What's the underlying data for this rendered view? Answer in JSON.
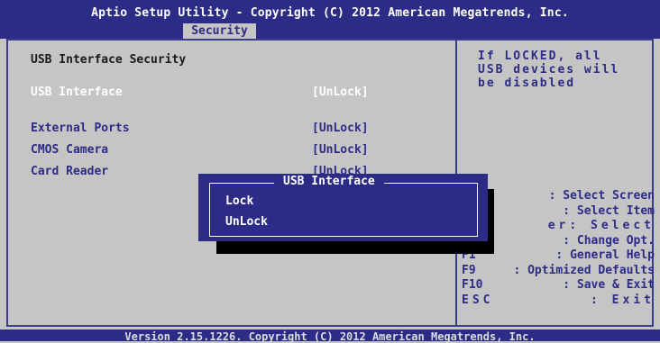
{
  "header": {
    "title": "Aptio Setup Utility - Copyright (C) 2012 American Megatrends, Inc.",
    "active_tab": "Security"
  },
  "main": {
    "heading": "USB Interface Security",
    "items": [
      {
        "label": "USB Interface",
        "value": "[UnLock]",
        "selected": true
      },
      {
        "label": "External Ports",
        "value": "[UnLock]",
        "selected": false
      },
      {
        "label": "CMOS Camera",
        "value": "[UnLock]",
        "selected": false
      },
      {
        "label": "Card Reader",
        "value": "[UnLock]",
        "selected": false
      }
    ]
  },
  "help": {
    "line1": "If LOCKED, all",
    "line2": "USB devices will",
    "line3": "be disabled"
  },
  "keys": [
    {
      "key": "",
      "desc": ": Select Screen"
    },
    {
      "key": "",
      "desc": ": Select Item"
    },
    {
      "key": "",
      "desc": "er: Select"
    },
    {
      "key": "",
      "desc": ": Change Opt."
    },
    {
      "key": "F1",
      "desc": ": General Help"
    },
    {
      "key": "F9",
      "desc": ": Optimized Defaults"
    },
    {
      "key": "F10",
      "desc": ": Save & Exit"
    },
    {
      "key": "ESC",
      "desc": ": Exit"
    }
  ],
  "popup": {
    "title": "USB Interface",
    "options": [
      "Lock",
      "UnLock"
    ]
  },
  "footer": "Version 2.15.1226. Copyright (C) 2012 American Megatrends, Inc.",
  "colors": {
    "header_blue": "#2c2c86",
    "panel_gray": "#c5c5c5"
  }
}
